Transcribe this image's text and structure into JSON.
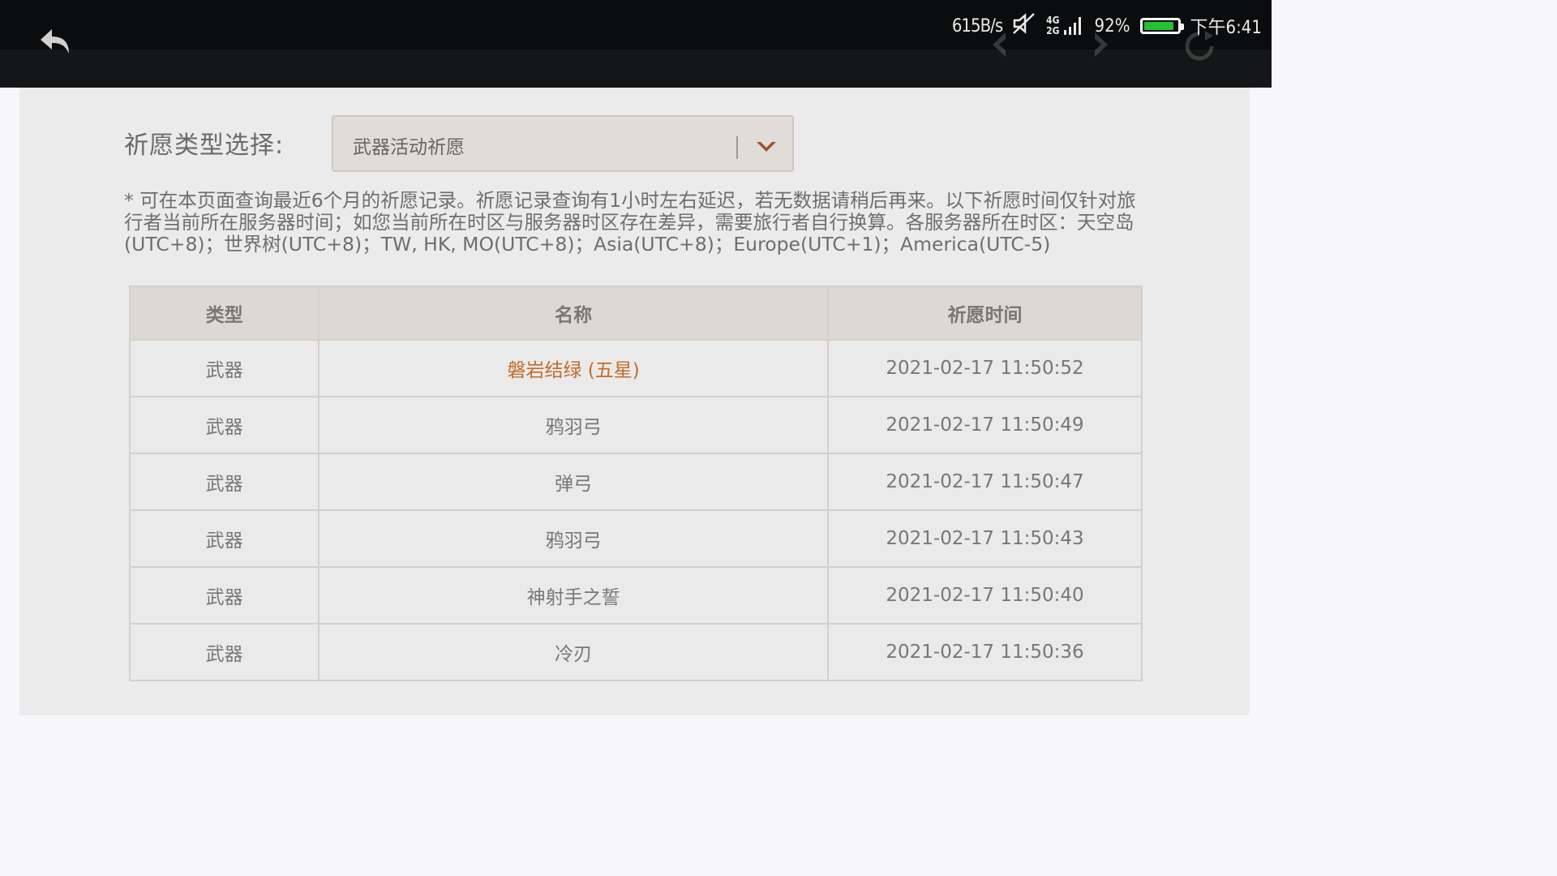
{
  "status_bar": {
    "network_speed": "615B/s",
    "signal_labels": [
      "4G",
      "2G"
    ],
    "battery_percent": "92%",
    "battery_level": 0.92,
    "time": "下午6:41"
  },
  "filter": {
    "label": "祈愿类型选择:",
    "selected": "武器活动祈愿"
  },
  "notice": "* 可在本页面查询最近6个月的祈愿记录。祈愿记录查询有1小时左右延迟，若无数据请稍后再来。以下祈愿时间仅针对旅行者当前所在服务器时间；如您当前所在时区与服务器时区存在差异，需要旅行者自行换算。各服务器所在时区：天空岛(UTC+8)；世界树(UTC+8)；TW, HK, MO(UTC+8)；Asia(UTC+8)；Europe(UTC+1)；America(UTC-5)",
  "table": {
    "headers": [
      "类型",
      "名称",
      "祈愿时间"
    ],
    "rows": [
      {
        "type": "武器",
        "name": "磐岩结绿 (五星)",
        "time": "2021-02-17 11:50:52",
        "rarity": "5-star"
      },
      {
        "type": "武器",
        "name": "鸦羽弓",
        "time": "2021-02-17 11:50:49"
      },
      {
        "type": "武器",
        "name": "弹弓",
        "time": "2021-02-17 11:50:47"
      },
      {
        "type": "武器",
        "name": "鸦羽弓",
        "time": "2021-02-17 11:50:43"
      },
      {
        "type": "武器",
        "name": "神射手之誓",
        "time": "2021-02-17 11:50:40"
      },
      {
        "type": "武器",
        "name": "冷刃",
        "time": "2021-02-17 11:50:36"
      }
    ]
  },
  "colors": {
    "five_star": "#c56a2a",
    "battery": "#22c235",
    "topbar": "#151617"
  }
}
